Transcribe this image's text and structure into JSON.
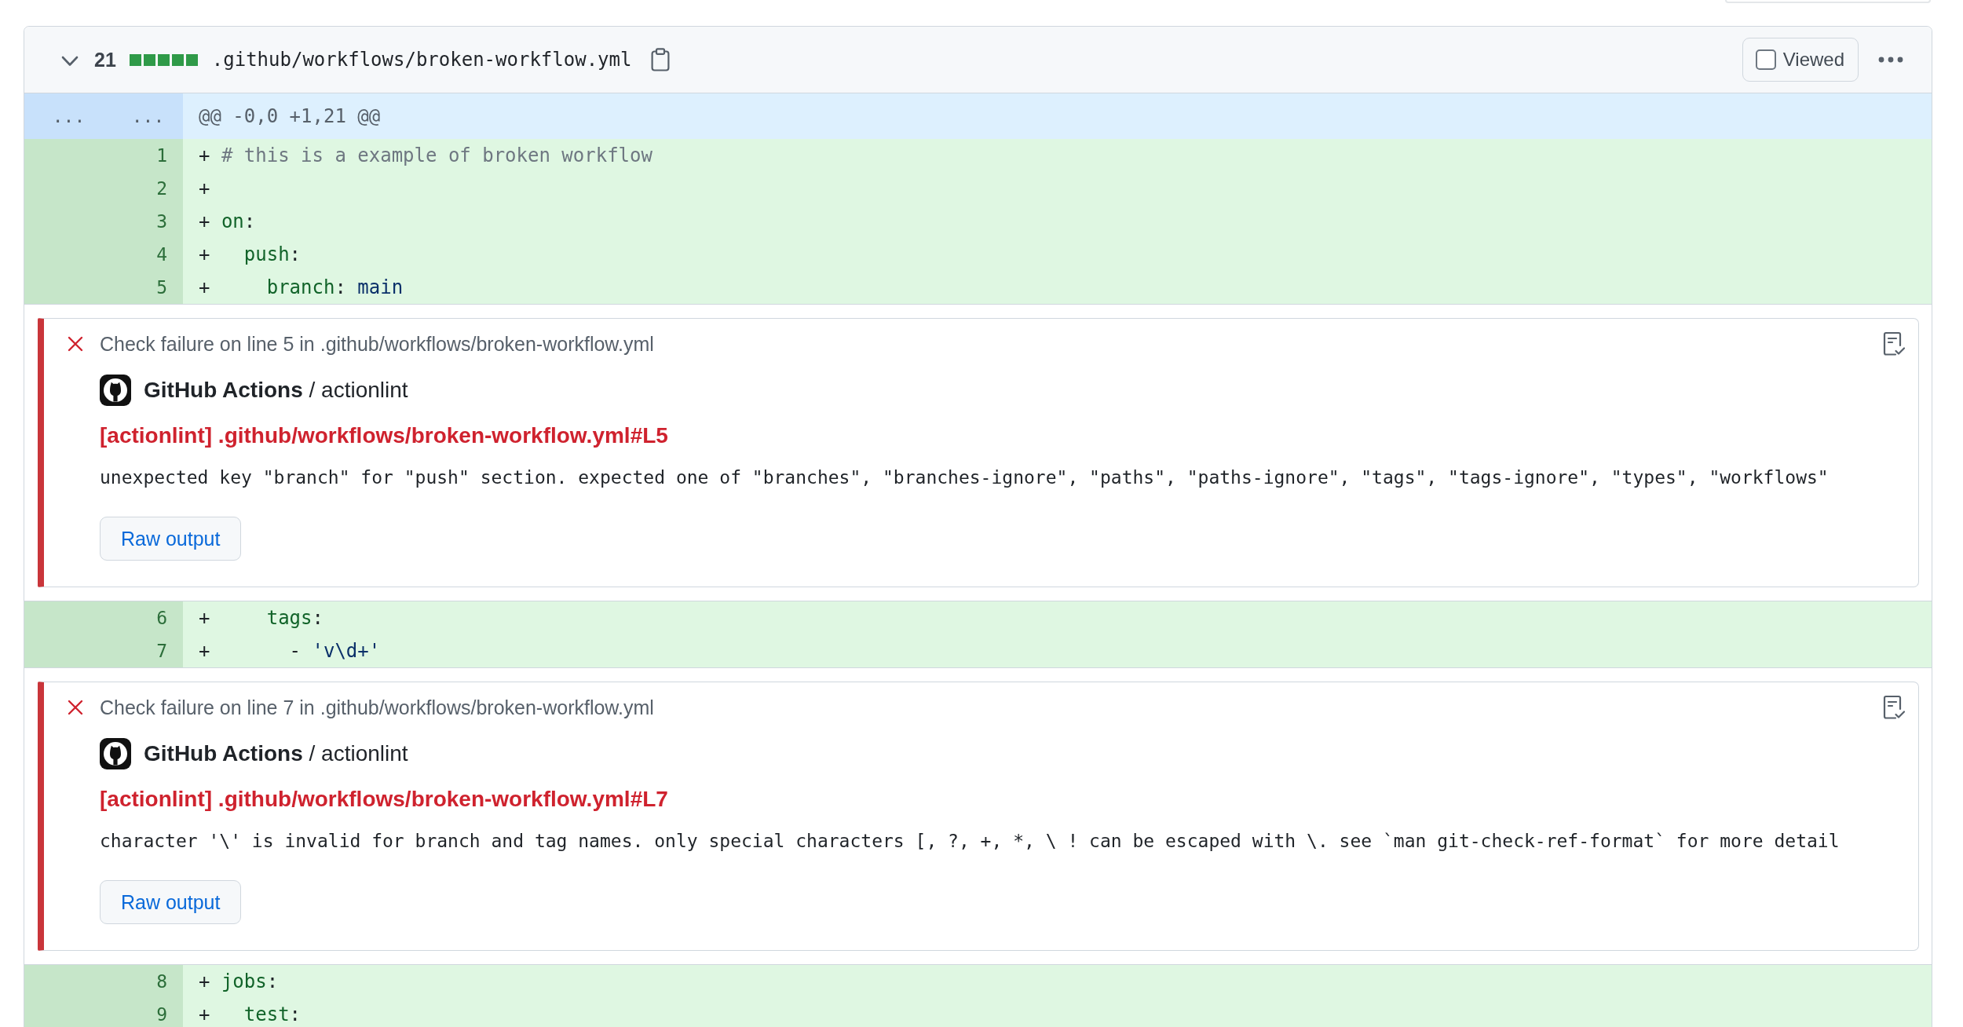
{
  "file": {
    "expanded": true,
    "changes": "21",
    "diffstat": [
      {
        "kind": "added"
      },
      {
        "kind": "added"
      },
      {
        "kind": "added"
      },
      {
        "kind": "added"
      },
      {
        "kind": "added"
      }
    ],
    "path": ".github/workflows/broken-workflow.yml",
    "viewed": {
      "label": "Viewed",
      "checked": false
    }
  },
  "diff": {
    "hunk": {
      "old_expander": "...",
      "new_expander": "...",
      "header": "@@ -0,0 +1,21 @@"
    },
    "rows": [
      {
        "kind": "line",
        "number": "1",
        "marker": "+",
        "tokens": [
          {
            "text": "# this is a example of broken workflow",
            "kind": "comment"
          }
        ]
      },
      {
        "kind": "line",
        "number": "2",
        "marker": "+"
      },
      {
        "kind": "line",
        "number": "3",
        "marker": "+",
        "tokens": [
          {
            "text": "on",
            "kind": "key"
          },
          {
            "text": ":",
            "kind": "punct"
          }
        ]
      },
      {
        "kind": "line",
        "number": "4",
        "marker": "+",
        "tokens": [
          {
            "text": "  push",
            "kind": "key"
          },
          {
            "text": ":",
            "kind": "punct"
          }
        ]
      },
      {
        "kind": "line",
        "number": "5",
        "marker": "+",
        "tokens": [
          {
            "text": "    branch",
            "kind": "key"
          },
          {
            "text": ": ",
            "kind": "punct"
          },
          {
            "text": "main",
            "kind": "string"
          }
        ]
      },
      {
        "kind": "failure",
        "heading": "Check failure on line 5 in .github/workflows/broken-workflow.yml",
        "source": "**GitHub Actions** / actionlint",
        "title": "[actionlint] .github/workflows/broken-workflow.yml#L5",
        "message": "unexpected key \"branch\" for \"push\" section. expected one of \"branches\", \"branches-ignore\", \"paths\", \"paths-ignore\", \"tags\", \"tags-ignore\", \"types\", \"workflows\"",
        "button": "Raw output"
      },
      {
        "kind": "line",
        "number": "6",
        "marker": "+",
        "tokens": [
          {
            "text": "    tags",
            "kind": "key"
          },
          {
            "text": ":",
            "kind": "punct"
          }
        ]
      },
      {
        "kind": "line",
        "number": "7",
        "marker": "+",
        "tokens": [
          {
            "text": "      - ",
            "kind": "plain"
          },
          {
            "text": "'v\\d+'",
            "kind": "string"
          }
        ]
      },
      {
        "kind": "failure",
        "heading": "Check failure on line 7 in .github/workflows/broken-workflow.yml",
        "source": "**GitHub Actions** / actionlint",
        "title": "[actionlint] .github/workflows/broken-workflow.yml#L7",
        "message": "character '\\' is invalid for branch and tag names. only special characters [, ?, +, *, \\ ! can be escaped with \\. see `man git-check-ref-format` for more detail",
        "button": "Raw output"
      },
      {
        "kind": "line",
        "number": "8",
        "marker": "+",
        "tokens": [
          {
            "text": "jobs",
            "kind": "key"
          },
          {
            "text": ":",
            "kind": "punct"
          }
        ]
      },
      {
        "kind": "line",
        "number": "9",
        "marker": "+",
        "tokens": [
          {
            "text": "  test",
            "kind": "key"
          },
          {
            "text": ":",
            "kind": "punct"
          }
        ]
      }
    ]
  }
}
